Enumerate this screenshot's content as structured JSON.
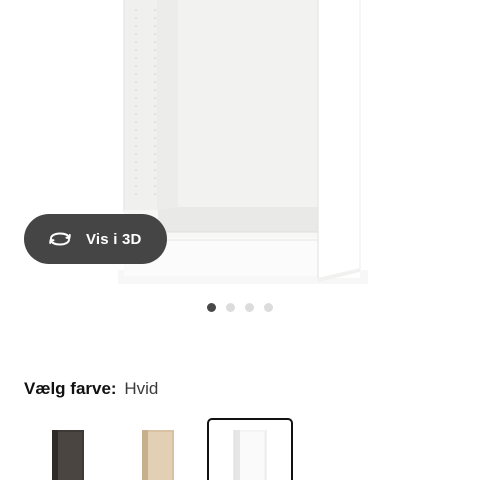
{
  "product_view": {
    "view_3d_label": "Vis i 3D",
    "icons": {
      "rotate": "rotate-3d-icon"
    },
    "carousel": {
      "total_images": 4,
      "active_index": 0
    }
  },
  "color_selector": {
    "label": "Vælg farve:",
    "selected_value": "Hvid",
    "options": [
      {
        "name": "black-brown",
        "color": "#3d3935",
        "selected": false
      },
      {
        "name": "white-stained-oak",
        "color": "#d9c2a3",
        "selected": false
      },
      {
        "name": "white",
        "color": "#f4f4f4",
        "selected": true
      }
    ]
  },
  "colors": {
    "pill_background": "#454545",
    "dot_active": "#484848",
    "dot_inactive": "#dcdcdc",
    "selected_border": "#111111"
  }
}
